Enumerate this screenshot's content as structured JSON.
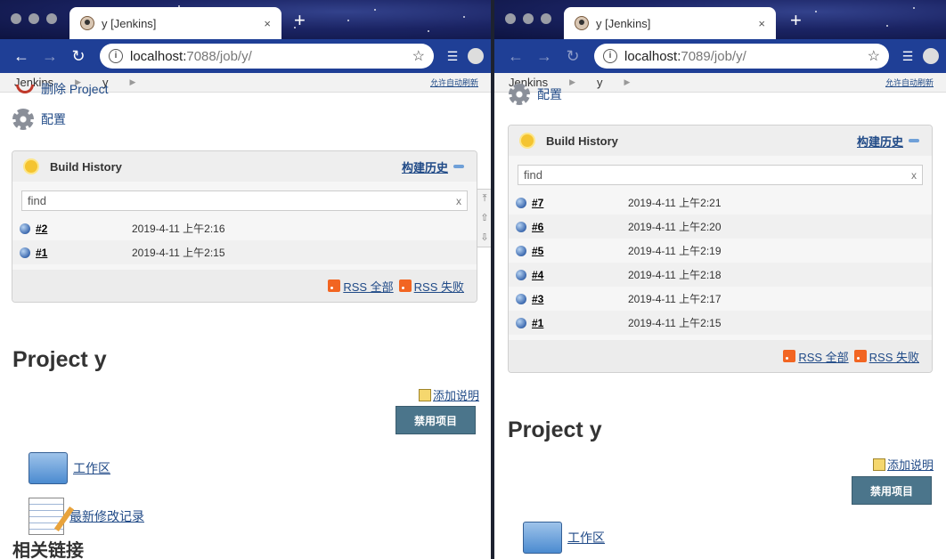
{
  "left": {
    "tab": {
      "title": "y [Jenkins]",
      "close": "×",
      "new_tab": "+"
    },
    "address": {
      "host": "localhost:",
      "port_path": "7088/job/y/"
    },
    "breadcrumb": {
      "root": "Jenkins",
      "job": "y",
      "auto_refresh": "允许自动刷新"
    },
    "side": {
      "delete_label": "删除 Project",
      "config_label": "配置"
    },
    "build_history": {
      "title": "Build History",
      "trend": "构建历史",
      "find_placeholder": "find",
      "clear": "x",
      "builds": [
        {
          "number": "#2",
          "date": "2019-4-11 上午2:16"
        },
        {
          "number": "#1",
          "date": "2019-4-11 上午2:15"
        }
      ],
      "rss_all": "RSS 全部",
      "rss_failed": "RSS 失败"
    },
    "project_title": "Project y",
    "add_description": "添加说明",
    "disable_button": "禁用项目",
    "workspace_link": "工作区",
    "changes_link": "最新修改记录",
    "related_heading": "相关链接"
  },
  "right": {
    "tab": {
      "title": "y [Jenkins]",
      "close": "×",
      "new_tab": "+"
    },
    "address": {
      "host": "localhost:",
      "port_path": "7089/job/y/"
    },
    "breadcrumb": {
      "root": "Jenkins",
      "job": "y",
      "auto_refresh": "允许自动刷新"
    },
    "side": {
      "config_label": "配置"
    },
    "build_history": {
      "title": "Build History",
      "trend": "构建历史",
      "find_placeholder": "find",
      "clear": "x",
      "builds": [
        {
          "number": "#7",
          "date": "2019-4-11 上午2:21"
        },
        {
          "number": "#6",
          "date": "2019-4-11 上午2:20"
        },
        {
          "number": "#5",
          "date": "2019-4-11 上午2:19"
        },
        {
          "number": "#4",
          "date": "2019-4-11 上午2:18"
        },
        {
          "number": "#3",
          "date": "2019-4-11 上午2:17"
        },
        {
          "number": "#1",
          "date": "2019-4-11 上午2:15"
        }
      ],
      "rss_all": "RSS 全部",
      "rss_failed": "RSS 失败"
    },
    "project_title": "Project y",
    "add_description": "添加说明",
    "disable_button": "禁用项目",
    "workspace_link": "工作区"
  }
}
